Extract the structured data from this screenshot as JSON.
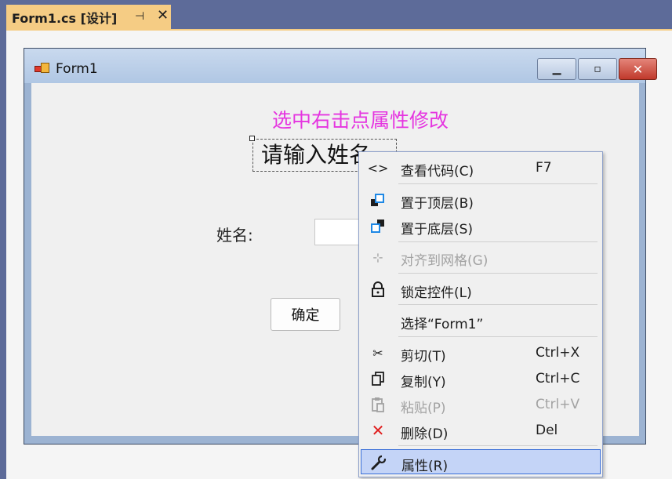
{
  "tab": {
    "title": "Form1.cs [设计]",
    "pin_icon": "pin-icon",
    "close_icon": "close-icon"
  },
  "form": {
    "title": "Form1",
    "hint_text": "选中右击点属性修改",
    "selected_label_text": "请输入姓名",
    "name_label": "姓名:",
    "name_input_value": "",
    "ok_button": "确定"
  },
  "context_menu": {
    "items": [
      {
        "label": "查看代码(C)",
        "shortcut": "F7",
        "icon": "code-icon",
        "enabled": true
      },
      {
        "label": "置于顶层(B)",
        "shortcut": "",
        "icon": "bring-to-front-icon",
        "enabled": true
      },
      {
        "label": "置于底层(S)",
        "shortcut": "",
        "icon": "send-to-back-icon",
        "enabled": true
      },
      {
        "label": "对齐到网格(G)",
        "shortcut": "",
        "icon": "align-grid-icon",
        "enabled": false
      },
      {
        "label": "锁定控件(L)",
        "shortcut": "",
        "icon": "lock-icon",
        "enabled": true
      },
      {
        "label": "选择“Form1”",
        "shortcut": "",
        "icon": "",
        "enabled": true
      },
      {
        "label": "剪切(T)",
        "shortcut": "Ctrl+X",
        "icon": "cut-icon",
        "enabled": true
      },
      {
        "label": "复制(Y)",
        "shortcut": "Ctrl+C",
        "icon": "copy-icon",
        "enabled": true
      },
      {
        "label": "粘贴(P)",
        "shortcut": "Ctrl+V",
        "icon": "paste-icon",
        "enabled": false
      },
      {
        "label": "删除(D)",
        "shortcut": "Del",
        "icon": "delete-icon",
        "enabled": true
      },
      {
        "label": "属性(R)",
        "shortcut": "",
        "icon": "wrench-icon",
        "enabled": true,
        "highlighted": true
      }
    ]
  },
  "colors": {
    "hint": "#e535e0",
    "tab": "#f5cc84",
    "menu_highlight": "#c4d4f7",
    "delete_icon": "#e01e1e"
  }
}
